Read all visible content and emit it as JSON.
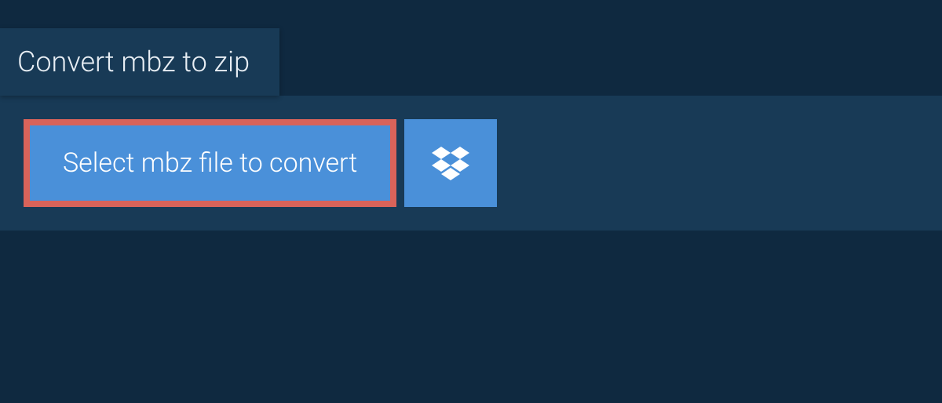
{
  "header": {
    "title": "Convert mbz to zip"
  },
  "actions": {
    "select_file_label": "Select mbz file to convert",
    "dropbox_icon": "dropbox"
  },
  "colors": {
    "background": "#0f2940",
    "panel": "#183a56",
    "button": "#4a90d9",
    "highlight_border": "#d9635a"
  }
}
